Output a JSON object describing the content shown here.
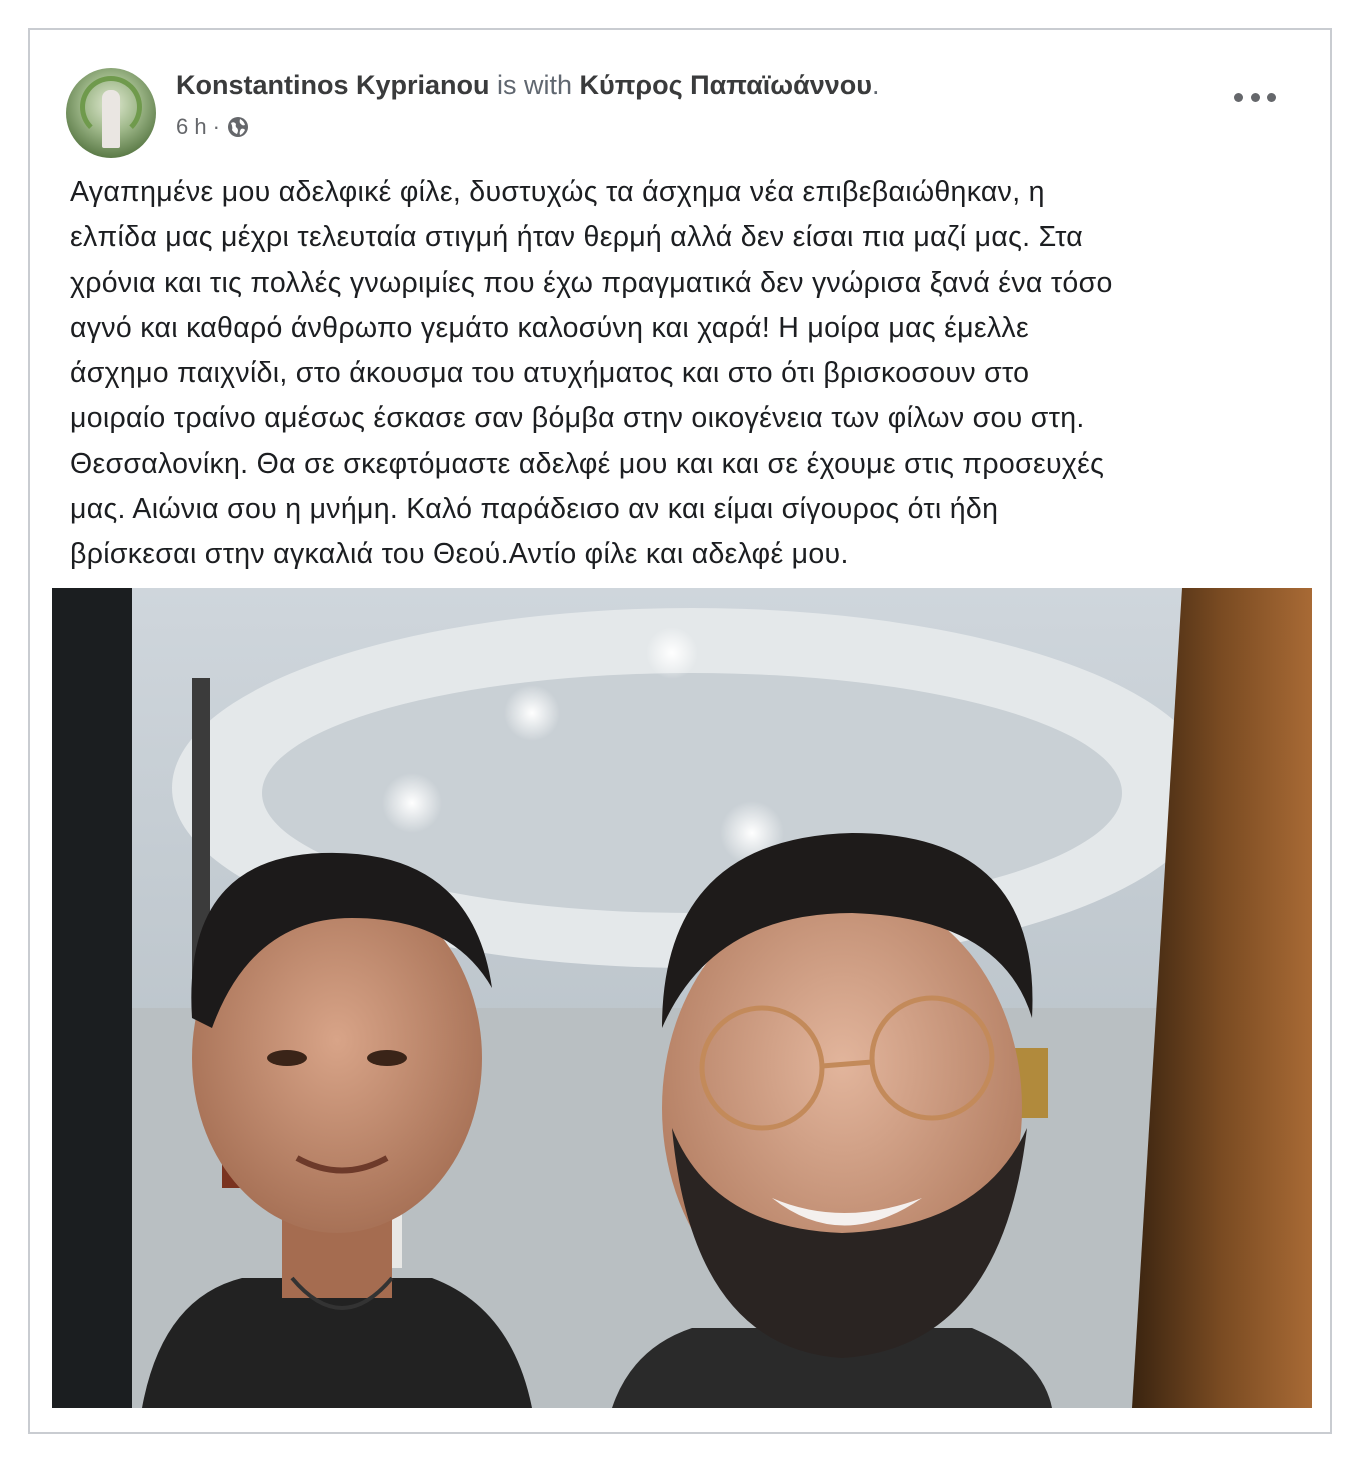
{
  "post": {
    "author": "Konstantinos Kyprianou",
    "with_text": " is with ",
    "tagged": "Κύπρος Παπαϊωάννου",
    "tagged_suffix": ".",
    "time": "6 h",
    "time_sep": " · ",
    "privacy_icon": "globe-icon",
    "more_icon": "more-options-icon",
    "body_lines": [
      "Αγαπημένε μου αδελφικέ φίλε, δυστυχώς τα άσχημα νέα επιβεβαιώθηκαν, η",
      "ελπίδα μας μέχρι τελευταία στιγμή ήταν θερμή αλλά δεν είσαι πια μαζί μας. Στα",
      "χρόνια και τις πολλές γνωριμίες που έχω πραγματικά δεν γνώρισα ξανά ένα τόσο",
      "αγνό και καθαρό άνθρωπο γεμάτο καλοσύνη και χαρά!  Η μοίρα μας έμελλε",
      "άσχημο παιχνίδι, στο άκουσμα του ατυχήματος και στο ότι βρισκοσουν στο",
      "μοιραίο τραίνο αμέσως έσκασε σαν βόμβα στην οικογένεια των φίλων σου στη.",
      "Θεσσαλονίκη. Θα σε σκεφτόμαστε αδελφέ μου και και σε έχουμε στις προσευχές",
      "μας. Αιώνια σου η μνήμη. Καλό παράδεισο αν και είμαι σίγουρος ότι ήδη",
      "βρίσκεσαι στην αγκαλιά του Θεού.Αντίο φίλε και αδελφέ μου."
    ]
  },
  "colors": {
    "name": "#3a3b3c",
    "secondary": "#65676b",
    "text": "#1c1e21",
    "border": "#c9ccd1"
  }
}
